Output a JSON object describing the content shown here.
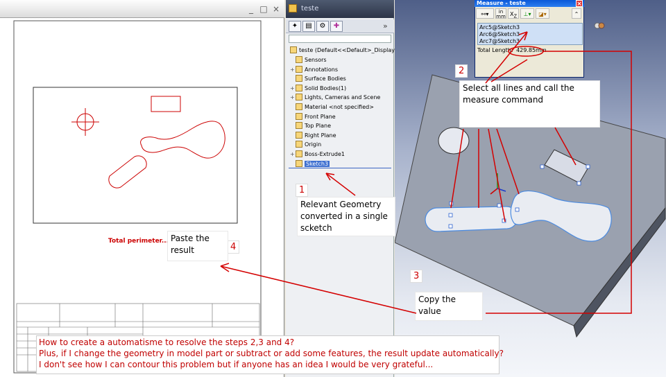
{
  "left_window": {
    "minimize": "_",
    "restore": "□",
    "close": "×"
  },
  "tree": {
    "title": "teste",
    "expand_chevron": "»",
    "root_label": "teste  (Default<<Default>_Display S",
    "items": [
      {
        "label": "Sensors",
        "icon": "sensors-icon",
        "expand": ""
      },
      {
        "label": "Annotations",
        "icon": "annotations-icon",
        "expand": "+"
      },
      {
        "label": "Surface Bodies",
        "icon": "surface-bodies-icon",
        "expand": ""
      },
      {
        "label": "Solid Bodies(1)",
        "icon": "solid-bodies-icon",
        "expand": "+"
      },
      {
        "label": "Lights, Cameras and Scene",
        "icon": "lights-icon",
        "expand": "+"
      },
      {
        "label": "Material <not specified>",
        "icon": "material-icon",
        "expand": ""
      },
      {
        "label": "Front Plane",
        "icon": "plane-icon",
        "expand": ""
      },
      {
        "label": "Top Plane",
        "icon": "plane-icon",
        "expand": ""
      },
      {
        "label": "Right Plane",
        "icon": "plane-icon",
        "expand": ""
      },
      {
        "label": "Origin",
        "icon": "origin-icon",
        "expand": ""
      },
      {
        "label": "Boss-Extrude1",
        "icon": "extrude-icon",
        "expand": "+"
      },
      {
        "label": "Sketch3",
        "icon": "sketch-icon",
        "expand": ""
      }
    ]
  },
  "measure": {
    "title": "Measure - teste",
    "close": "×",
    "units_top": "in",
    "units_bottom": "mm",
    "selections": [
      "Arc5@Sketch3",
      "Arc6@Sketch3",
      "Arc7@Sketch3"
    ],
    "result_label": "Total Length:",
    "result_value": "429.85mm"
  },
  "drawing": {
    "total_perimeter": "Total perimeter....."
  },
  "annotations": {
    "n1": "1",
    "t1": [
      "Relevant Geometry",
      "converted in a single",
      "scketch"
    ],
    "n2": "2",
    "t2": [
      "Select all lines and call the",
      "measure command"
    ],
    "n3": "3",
    "t3": "Copy the value",
    "n4": "4",
    "t4": [
      "Paste the",
      "result"
    ]
  },
  "bottom_note": [
    "How to create a automatisme to resolve the steps 2,3 and 4?",
    "Plus, if I change the geometry in model part or subtract or add some features, the result update automatically?",
    "I don't see how I can contour this problem but if anyone has an idea I would be very grateful..."
  ],
  "colors": {
    "annotation_red": "#d40000",
    "selection_blue": "#3d6fd0"
  }
}
